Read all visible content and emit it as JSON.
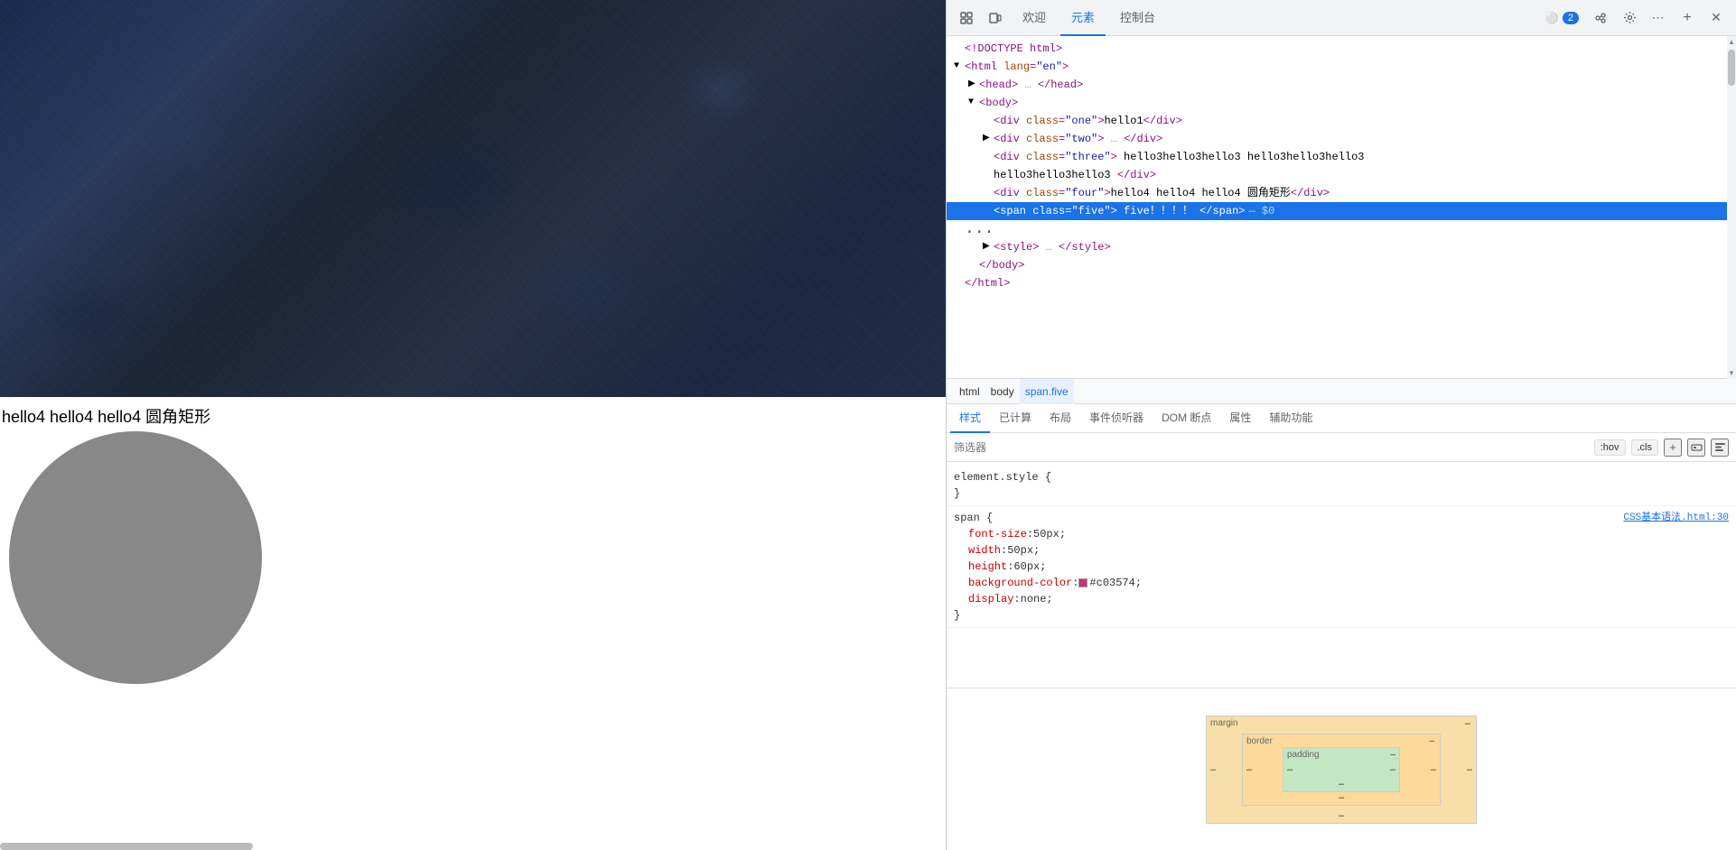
{
  "browser": {
    "content_area": {
      "text_hello4": "hello4 hello4 hello4 圆角矩形"
    }
  },
  "devtools": {
    "toolbar": {
      "tabs": [
        {
          "label": "欢迎",
          "active": false
        },
        {
          "label": "元素",
          "active": true
        },
        {
          "label": "控制台",
          "active": false
        }
      ],
      "badge_count": "2",
      "more_btn": "⋯",
      "add_btn": "+",
      "close_btn": "✕"
    },
    "dom_tree": {
      "lines": [
        {
          "indent": 0,
          "html": "<!DOCTYPE html>",
          "type": "doctype"
        },
        {
          "indent": 0,
          "html": "<html lang=\"en\">",
          "type": "open"
        },
        {
          "indent": 1,
          "html": "<head> … </head>",
          "type": "collapsed"
        },
        {
          "indent": 1,
          "html": "<body>",
          "type": "open",
          "arrow": "open"
        },
        {
          "indent": 2,
          "html": "<div class=\"one\">hello1</div>",
          "type": "element"
        },
        {
          "indent": 2,
          "html": "<div class=\"two\"> … </div>",
          "type": "collapsed",
          "arrow": "closed"
        },
        {
          "indent": 2,
          "html": "<div class=\"three\"> hello3hello3hello3 hello3hello3hello3",
          "type": "text"
        },
        {
          "indent": 2,
          "html": "hello3hello3hello3 </div>",
          "type": "text2"
        },
        {
          "indent": 2,
          "html": "<div class=\"four\">hello4 hello4 hello4 圆角矩形</div>",
          "type": "element"
        },
        {
          "indent": 2,
          "html": "<span class=\"five\"> five！！！！ </span>",
          "type": "selected",
          "comment": "— $0"
        },
        {
          "indent": 2,
          "html": "<style> … </style>",
          "type": "collapsed",
          "arrow": "closed"
        },
        {
          "indent": 1,
          "html": "</body>",
          "type": "close"
        },
        {
          "indent": 0,
          "html": "</html>",
          "type": "close"
        }
      ],
      "dots_label": "..."
    },
    "breadcrumb": [
      {
        "label": "html",
        "active": false
      },
      {
        "label": "body",
        "active": false
      },
      {
        "label": "span.five",
        "active": true
      }
    ],
    "sub_tabs": [
      {
        "label": "样式",
        "active": true
      },
      {
        "label": "已计算",
        "active": false
      },
      {
        "label": "布局",
        "active": false
      },
      {
        "label": "事件侦听器",
        "active": false
      },
      {
        "label": "DOM 断点",
        "active": false
      },
      {
        "label": "属性",
        "active": false
      },
      {
        "label": "辅助功能",
        "active": false
      }
    ],
    "filter": {
      "placeholder": "筛选器",
      "hov_label": ":hov",
      "cls_label": ".cls"
    },
    "css_rules": [
      {
        "selector": "element.style {",
        "source": "",
        "properties": [],
        "close": "}"
      },
      {
        "selector": "span {",
        "source": "CSS基本语法.html:30",
        "properties": [
          {
            "name": "font-size",
            "value": "50px;"
          },
          {
            "name": "width",
            "value": "50px;"
          },
          {
            "name": "height",
            "value": "60px;"
          },
          {
            "name": "background-color",
            "value": "#c03574;",
            "swatch": "#c03574"
          },
          {
            "name": "display",
            "value": "none;"
          }
        ],
        "close": "}"
      }
    ],
    "box_model": {
      "margin_label": "margin",
      "margin_dash": "–",
      "border_label": "border",
      "border_dash": "–",
      "padding_label": "padding",
      "padding_dash": "–"
    }
  }
}
